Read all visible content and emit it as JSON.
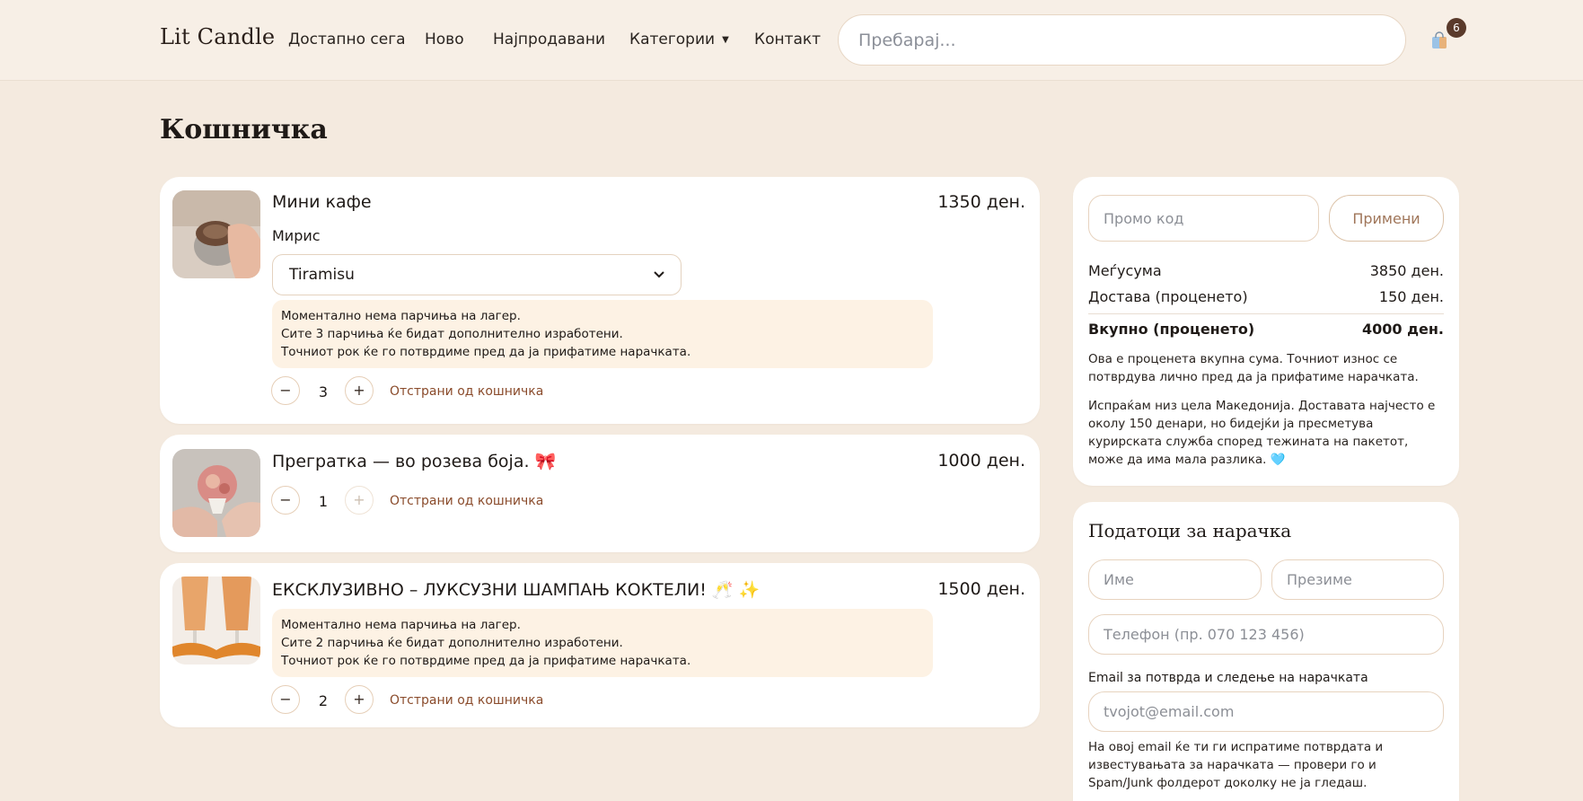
{
  "header": {
    "brand": "Lit Candle",
    "nav": [
      {
        "label": "Достапно сега"
      },
      {
        "label": "Ново"
      },
      {
        "label": "Најпродавани"
      },
      {
        "label": "Категории"
      },
      {
        "label": "Контакт"
      }
    ],
    "search_placeholder": "Пребарај...",
    "cart_count": "6"
  },
  "page": {
    "title": "Кошничка"
  },
  "cart": {
    "items": [
      {
        "name": "Мини кафе",
        "price": "1350 ден.",
        "option_label": "Мирис",
        "option_value": "Tiramisu",
        "notice": [
          "Моментално нема парчиња на лагер.",
          "Сите 3 парчиња ќе бидат дополнително изработени.",
          "Точниот рок ќе го потврдиме пред да ја прифатиме нарачката."
        ],
        "quantity": "3",
        "remove_label": "Отстрани од кошничка"
      },
      {
        "name": "Прегратка — во розева боја. 🎀",
        "price": "1000 ден.",
        "quantity": "1",
        "remove_label": "Отстрани од кошничка"
      },
      {
        "name": "ЕКСКЛУЗИВНО – ЛУКСУЗНИ ШАМПАЊ КОКТЕЛИ! 🥂 ✨",
        "price": "1500 ден.",
        "notice": [
          "Моментално нема парчиња на лагер.",
          "Сите 2 парчиња ќе бидат дополнително изработени.",
          "Точниот рок ќе го потврдиме пред да ја прифатиме нарачката."
        ],
        "quantity": "2",
        "remove_label": "Отстрани од кошничка"
      }
    ]
  },
  "summary": {
    "promo_placeholder": "Промо код",
    "apply_label": "Примени",
    "subtotal_label": "Меѓусума",
    "subtotal_value": "3850 ден.",
    "shipping_label": "Достава (проценето)",
    "shipping_value": "150 ден.",
    "total_label": "Вкупно (проценето)",
    "total_value": "4000 ден.",
    "note1": "Ова е проценета вкупна сума. Точниот износ се потврдува лично пред да ја прифатиме нарачката.",
    "note2": "Испраќам низ цела Македонија. Доставата најчесто е околу 150 денари, но бидејќи ја пресметува курирската служба според тежината на пакетот, може да има мала разлика. 🩵"
  },
  "order_form": {
    "title": "Податоци за нарачка",
    "first_name_placeholder": "Име",
    "last_name_placeholder": "Презиме",
    "phone_placeholder": "Телефон (пр. 070 123 456)",
    "email_label": "Email за потврда и следење на нарачката",
    "email_placeholder": "tvojot@email.com",
    "email_note": "На овој email ќе ти ги испратиме потврдата и известувањата за нарачката — провери го и Spam/Junk фолдерот доколку не ја гледаш."
  },
  "colors": {
    "background": "#f4eadf",
    "accent": "#8a4b2b",
    "badge": "#5a3a2b",
    "notice_bg": "#fdf2e4"
  }
}
